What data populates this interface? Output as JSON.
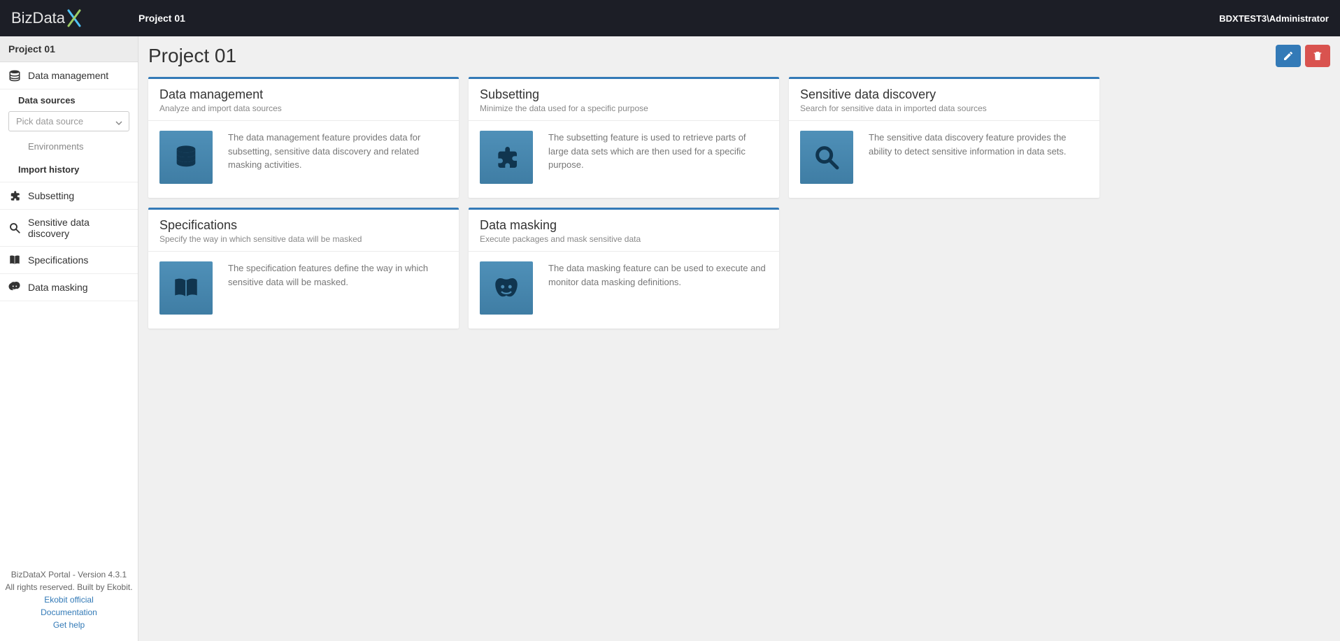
{
  "app": {
    "brand_prefix": "BizData",
    "brand_suffix": "X"
  },
  "header": {
    "title": "Project 01",
    "user": "BDXTEST3\\Administrator"
  },
  "sidebar": {
    "project": "Project 01",
    "nav": {
      "data_management": "Data management",
      "subsetting": "Subsetting",
      "sensitive": "Sensitive data discovery",
      "specifications": "Specifications",
      "data_masking": "Data masking"
    },
    "data_sources_label": "Data sources",
    "pick_placeholder": "Pick data source",
    "environments": "Environments",
    "import_history": "Import history",
    "footer": {
      "version": "BizDataX Portal - Version 4.3.1",
      "rights": "All rights reserved. Built by Ekobit.",
      "link1": "Ekobit official",
      "link2": "Documentation",
      "link3": "Get help"
    }
  },
  "page": {
    "title": "Project 01"
  },
  "cards": {
    "dm": {
      "title": "Data management",
      "sub": "Analyze and import data sources",
      "desc": "The data management feature provides data for subsetting, sensitive data discovery and related masking activities."
    },
    "sub": {
      "title": "Subsetting",
      "sub": "Minimize the data used for a specific purpose",
      "desc": "The subsetting feature is used to retrieve parts of large data sets which are then used for a specific purpose."
    },
    "sdd": {
      "title": "Sensitive data discovery",
      "sub": "Search for sensitive data in imported data sources",
      "desc": "The sensitive data discovery feature provides the ability to detect sensitive information in data sets."
    },
    "spec": {
      "title": "Specifications",
      "sub": "Specify the way in which sensitive data will be masked",
      "desc": "The specification features define the way in which sensitive data will be masked."
    },
    "mask": {
      "title": "Data masking",
      "sub": "Execute packages and mask sensitive data",
      "desc": "The data masking feature can be used to execute and monitor data masking definitions."
    }
  }
}
